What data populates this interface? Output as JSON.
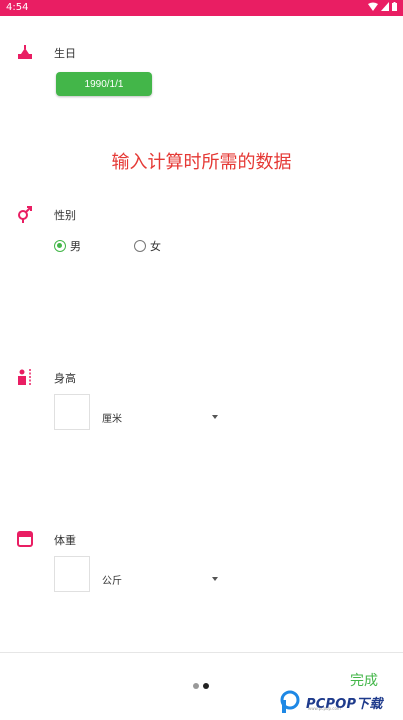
{
  "status_bar": {
    "time": "4:54",
    "bg_color": "#e91e63"
  },
  "birthday": {
    "label": "生日",
    "date_value": "1990/1/1",
    "icon": "birthday-cake-icon"
  },
  "headline": "输入计算时所需的数据",
  "gender": {
    "label": "性别",
    "icon": "gender-icon",
    "options": [
      {
        "label": "男",
        "selected": true
      },
      {
        "label": "女",
        "selected": false
      }
    ]
  },
  "height": {
    "label": "身高",
    "icon": "height-ruler-icon",
    "value": "",
    "unit": "厘米"
  },
  "weight": {
    "label": "体重",
    "icon": "scale-icon",
    "value": "",
    "unit": "公斤"
  },
  "footer": {
    "done_label": "完成",
    "page_indicator": {
      "pages": 2,
      "current": 2
    }
  },
  "watermark": {
    "brand": "PCPOP下载",
    "sub": "www.pcpop.com"
  },
  "colors": {
    "accent": "#e91e63",
    "green": "#43b649",
    "headline_red": "#e53935"
  }
}
